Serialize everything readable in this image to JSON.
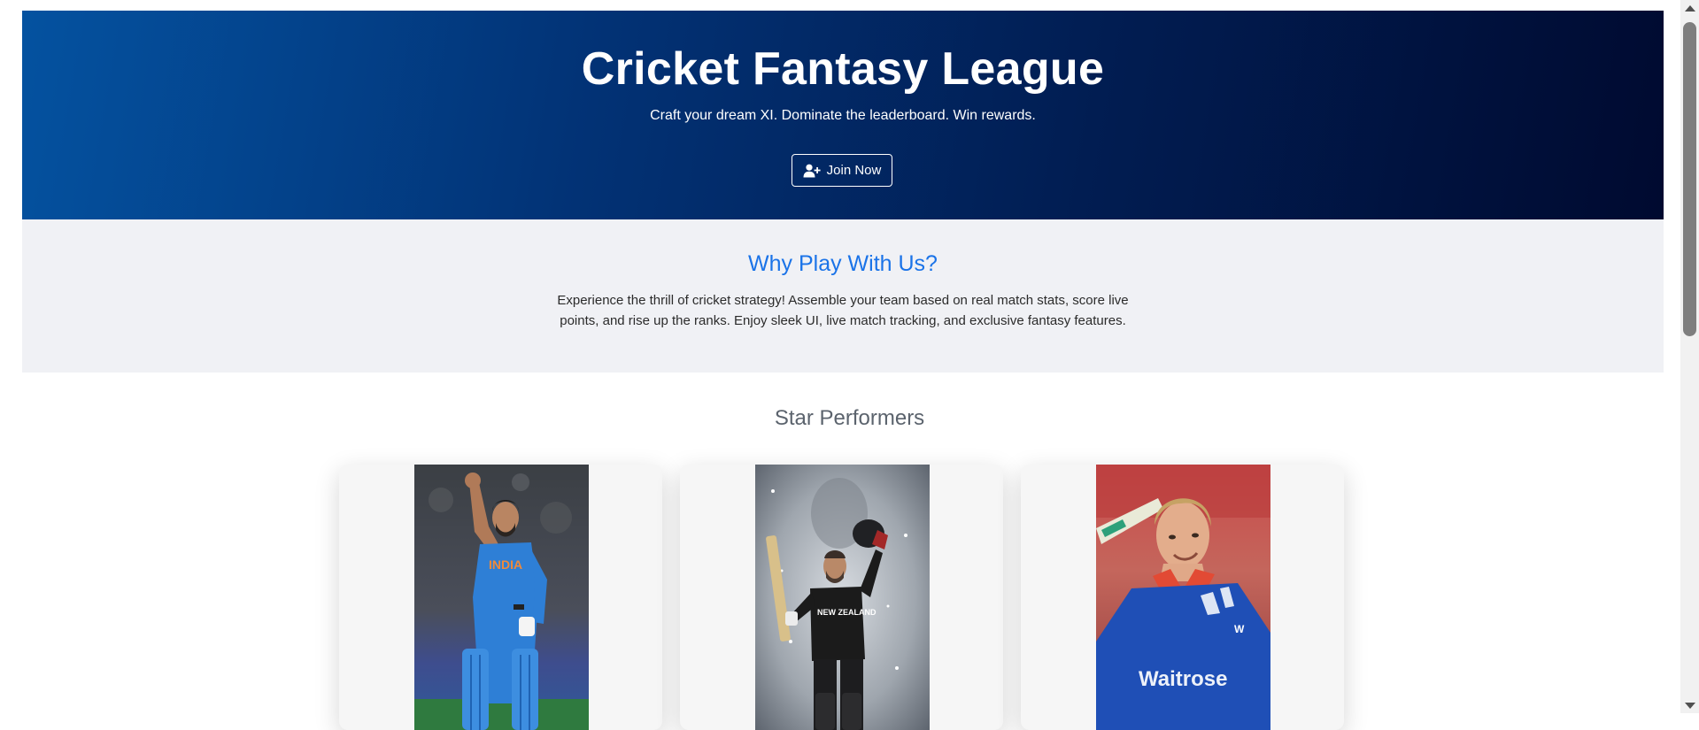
{
  "hero": {
    "title": "Cricket Fantasy League",
    "subtitle": "Craft your dream XI. Dominate the leaderboard. Win rewards.",
    "join_label": "Join Now",
    "join_icon": "user-plus-icon"
  },
  "why": {
    "title": "Why Play With Us?",
    "text": "Experience the thrill of cricket strategy! Assemble your team based on real match stats, score live points, and rise up the ranks. Enjoy sleek UI, live match tracking, and exclusive fantasy features."
  },
  "stars": {
    "title": "Star Performers",
    "players": [
      {
        "jersey": "INDIA",
        "kit_color": "#2e7fd6"
      },
      {
        "jersey": "NEW ZEALAND",
        "kit_color": "#1b1b1b"
      },
      {
        "jersey": "Waitrose",
        "kit_color": "#1f4fb6"
      }
    ]
  },
  "colors": {
    "hero_start": "#0452a0",
    "hero_end": "#000a30",
    "accent": "#1a73e8",
    "section_bg": "#f0f1f5"
  }
}
